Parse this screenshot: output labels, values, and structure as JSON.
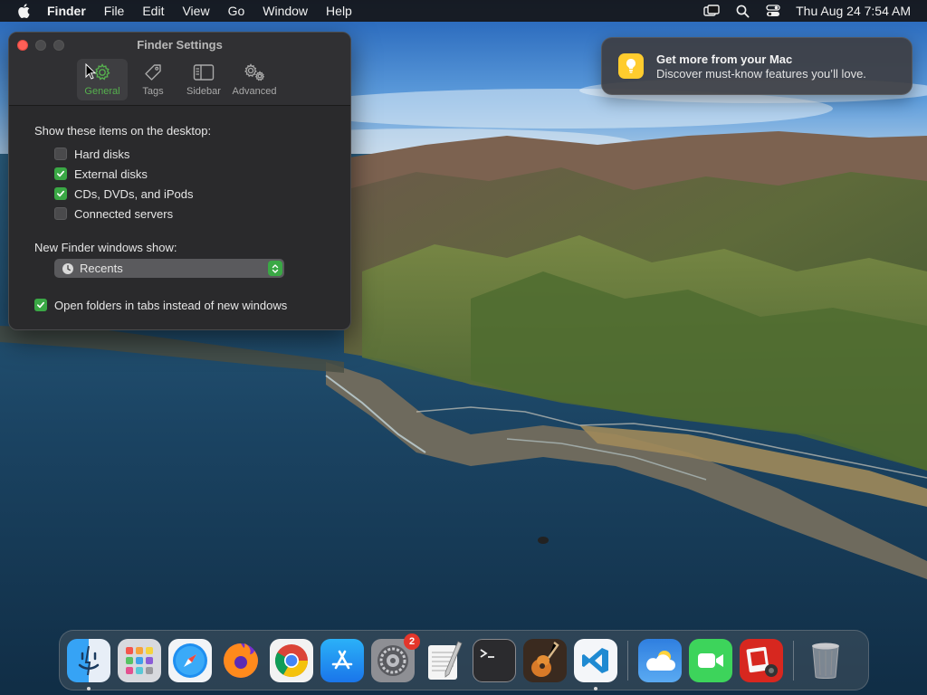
{
  "menubar": {
    "app_name": "Finder",
    "items": [
      "File",
      "Edit",
      "View",
      "Go",
      "Window",
      "Help"
    ],
    "clock": "Thu Aug 24  7:54 AM",
    "status_icons": [
      "display-icon",
      "search-icon",
      "control-center-icon"
    ]
  },
  "window": {
    "title": "Finder Settings",
    "tabs": [
      {
        "label": "General",
        "icon": "gear-icon",
        "active": true
      },
      {
        "label": "Tags",
        "icon": "tag-icon",
        "active": false
      },
      {
        "label": "Sidebar",
        "icon": "sidebar-icon",
        "active": false
      },
      {
        "label": "Advanced",
        "icon": "gears-icon",
        "active": false
      }
    ],
    "desktop_items_label": "Show these items on the desktop:",
    "desktop_items": [
      {
        "label": "Hard disks",
        "checked": false
      },
      {
        "label": "External disks",
        "checked": true
      },
      {
        "label": "CDs, DVDs, and iPods",
        "checked": true
      },
      {
        "label": "Connected servers",
        "checked": false
      }
    ],
    "new_windows_label": "New Finder windows show:",
    "new_windows_value": "Recents",
    "open_in_tabs": {
      "label": "Open folders in tabs instead of new windows",
      "checked": true
    }
  },
  "notification": {
    "title": "Get more from your Mac",
    "body": "Discover must-know features you’ll love.",
    "icon": "lightbulb-icon"
  },
  "dock": {
    "apps": [
      {
        "name": "Finder",
        "running": true
      },
      {
        "name": "Launchpad",
        "running": false
      },
      {
        "name": "Safari",
        "running": false
      },
      {
        "name": "Firefox",
        "running": false
      },
      {
        "name": "Chrome",
        "running": false
      },
      {
        "name": "App Store",
        "running": false
      },
      {
        "name": "System Settings",
        "running": false,
        "badge": "2"
      },
      {
        "name": "TextEdit",
        "running": false
      },
      {
        "name": "Terminal",
        "running": false
      },
      {
        "name": "GarageBand",
        "running": false
      },
      {
        "name": "Visual Studio Code",
        "running": true
      }
    ],
    "recent_apps": [
      {
        "name": "Weather"
      },
      {
        "name": "FaceTime"
      },
      {
        "name": "Photo Booth"
      }
    ],
    "trash": {
      "name": "Trash"
    }
  },
  "colors": {
    "accent_green": "#3aa845",
    "close_red": "#fe5f57",
    "badge_red": "#e4362b"
  }
}
